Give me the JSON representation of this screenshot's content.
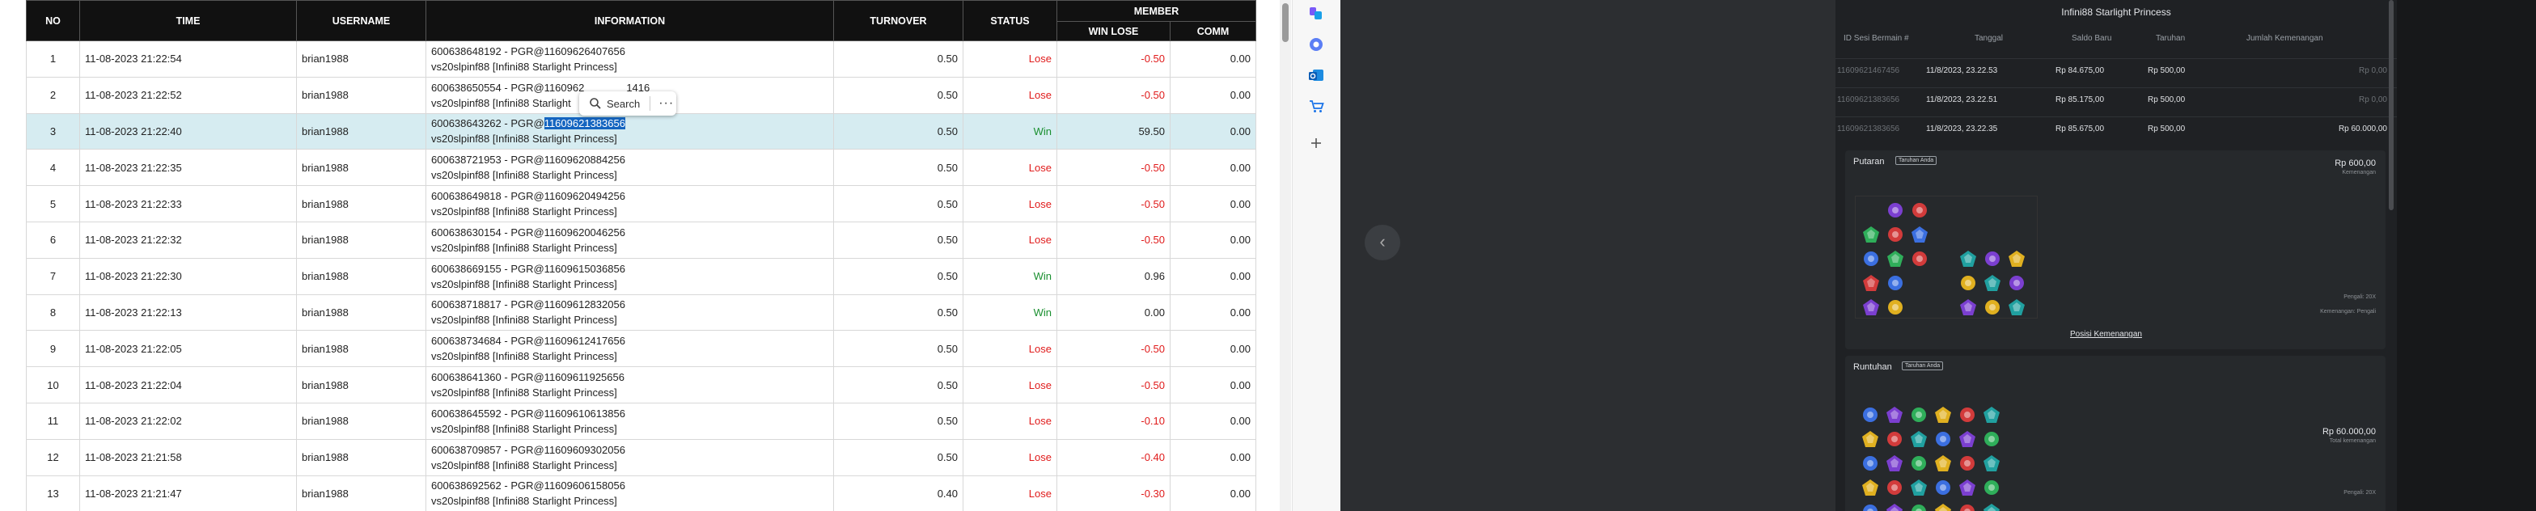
{
  "table": {
    "headers": {
      "no": "NO",
      "time": "TIME",
      "username": "USERNAME",
      "information": "INFORMATION",
      "turnover": "TURNOVER",
      "status": "STATUS",
      "member": "MEMBER",
      "win_lose": "WIN LOSE",
      "comm": "COMM"
    },
    "rows": [
      {
        "no": "1",
        "time": "11-08-2023 21:22:54",
        "user": "brian1988",
        "info1": "600638648192 - PGR@11609626407656",
        "info2": "vs20slpinf88 [Infini88 Starlight Princess]",
        "turnover": "0.50",
        "status": "Lose",
        "winlose": "-0.50",
        "comm": "0.00"
      },
      {
        "no": "2",
        "time": "11-08-2023 21:22:52",
        "user": "brian1988",
        "info1": "600638650554 - PGR@1160962",
        "info1b": "1416",
        "info2": "vs20slpinf88 [Infini88 Starlight",
        "info2b": "",
        "turnover": "0.50",
        "status": "Lose",
        "winlose": "-0.50",
        "comm": "0.00"
      },
      {
        "no": "3",
        "time": "11-08-2023 21:22:40",
        "user": "brian1988",
        "info1": "600638643262 - PGR@",
        "info1sel": "11609621383656",
        "info2": "vs20slpinf88 [Infini88 Starlight Princess]",
        "turnover": "0.50",
        "status": "Win",
        "winlose": "59.50",
        "comm": "0.00"
      },
      {
        "no": "4",
        "time": "11-08-2023 21:22:35",
        "user": "brian1988",
        "info1": "600638721953 - PGR@11609620884256",
        "info2": "vs20slpinf88 [Infini88 Starlight Princess]",
        "turnover": "0.50",
        "status": "Lose",
        "winlose": "-0.50",
        "comm": "0.00"
      },
      {
        "no": "5",
        "time": "11-08-2023 21:22:33",
        "user": "brian1988",
        "info1": "600638649818 - PGR@11609620494256",
        "info2": "vs20slpinf88 [Infini88 Starlight Princess]",
        "turnover": "0.50",
        "status": "Lose",
        "winlose": "-0.50",
        "comm": "0.00"
      },
      {
        "no": "6",
        "time": "11-08-2023 21:22:32",
        "user": "brian1988",
        "info1": "600638630154 - PGR@11609620046256",
        "info2": "vs20slpinf88 [Infini88 Starlight Princess]",
        "turnover": "0.50",
        "status": "Lose",
        "winlose": "-0.50",
        "comm": "0.00"
      },
      {
        "no": "7",
        "time": "11-08-2023 21:22:30",
        "user": "brian1988",
        "info1": "600638669155 - PGR@11609615036856",
        "info2": "vs20slpinf88 [Infini88 Starlight Princess]",
        "turnover": "0.50",
        "status": "Win",
        "winlose": "0.96",
        "comm": "0.00"
      },
      {
        "no": "8",
        "time": "11-08-2023 21:22:13",
        "user": "brian1988",
        "info1": "600638718817 - PGR@11609612832056",
        "info2": "vs20slpinf88 [Infini88 Starlight Princess]",
        "turnover": "0.50",
        "status": "Win",
        "winlose": "0.00",
        "comm": "0.00"
      },
      {
        "no": "9",
        "time": "11-08-2023 21:22:05",
        "user": "brian1988",
        "info1": "600638734684 - PGR@11609612417656",
        "info2": "vs20slpinf88 [Infini88 Starlight Princess]",
        "turnover": "0.50",
        "status": "Lose",
        "winlose": "-0.50",
        "comm": "0.00"
      },
      {
        "no": "10",
        "time": "11-08-2023 21:22:04",
        "user": "brian1988",
        "info1": "600638641360 - PGR@11609611925656",
        "info2": "vs20slpinf88 [Infini88 Starlight Princess]",
        "turnover": "0.50",
        "status": "Lose",
        "winlose": "-0.50",
        "comm": "0.00"
      },
      {
        "no": "11",
        "time": "11-08-2023 21:22:02",
        "user": "brian1988",
        "info1": "600638645592 - PGR@11609610613856",
        "info2": "vs20slpinf88 [Infini88 Starlight Princess]",
        "turnover": "0.50",
        "status": "Lose",
        "winlose": "-0.10",
        "comm": "0.00"
      },
      {
        "no": "12",
        "time": "11-08-2023 21:21:58",
        "user": "brian1988",
        "info1": "600638709857 - PGR@11609609302056",
        "info2": "vs20slpinf88 [Infini88 Starlight Princess]",
        "turnover": "0.50",
        "status": "Lose",
        "winlose": "-0.40",
        "comm": "0.00"
      },
      {
        "no": "13",
        "time": "11-08-2023 21:21:47",
        "user": "brian1988",
        "info1": "600638692562 - PGR@11609606158056",
        "info2": "vs20slpinf88 [Infini88 Starlight Princess]",
        "turnover": "0.40",
        "status": "Lose",
        "winlose": "-0.30",
        "comm": "0.00"
      }
    ]
  },
  "context_menu": {
    "search_label": "Search",
    "more": "···"
  },
  "icons": {
    "search": "search-icon",
    "copilot": "copilot-icon",
    "extension": "extension-icon",
    "outlook": "outlook-icon",
    "shopping": "shopping-icon",
    "add": "plus-icon",
    "nav": "chevron-left-icon"
  },
  "game": {
    "title": "Infini88 Starlight Princess",
    "headers": {
      "id": "ID Sesi Bermain #",
      "date": "Tanggal",
      "balance": "Saldo Baru",
      "bet": "Taruhan",
      "win": "Jumlah Kemenangan"
    },
    "rows": [
      {
        "id": "11609621467456",
        "date": "11/8/2023, 23.22.53",
        "balance": "Rp 84.675,00",
        "bet": "Rp 500,00",
        "win": "Rp 0,00"
      },
      {
        "id": "11609621383656",
        "date": "11/8/2023, 23.22.51",
        "balance": "Rp 85.175,00",
        "bet": "Rp 500,00",
        "win": "Rp 0,00"
      },
      {
        "id": "11609621383656",
        "date": "11/8/2023, 23.22.35",
        "balance": "Rp 85.675,00",
        "bet": "Rp 500,00",
        "win": "Rp 60.000,00"
      }
    ],
    "spin": {
      "label": "Putaran",
      "tag": "Taruhan Anda",
      "amount": "Rp 600,00",
      "sub": "Kemenangan",
      "side1": "Pengali: 20X",
      "side2": "Kemenangan: Pengali",
      "link": "Posisi Kemenangan"
    },
    "tumble": {
      "label": "Runtuhan",
      "tag": "Taruhan Anda",
      "amount": "Rp 60.000,00",
      "sub": "Total kemenangan",
      "side1": "Pengali: 20X"
    }
  },
  "colors": {
    "lose": "#e01b1b",
    "win": "#1a8f2f",
    "highlight_row": "#d6ecf1",
    "header_bg": "#111111",
    "game_bg": "#1f2124"
  }
}
